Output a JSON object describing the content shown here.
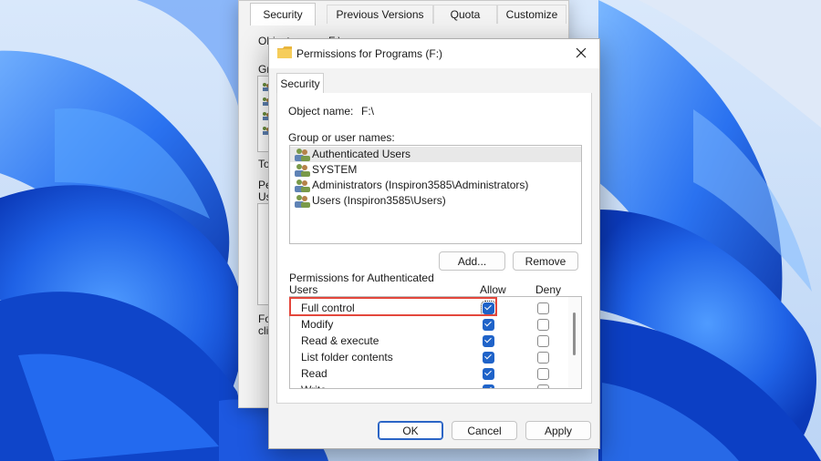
{
  "background_window": {
    "tabs": [
      "Security",
      "Previous Versions",
      "Quota",
      "Customize"
    ],
    "partial_labels": [
      "Object name:",
      "F:\\",
      "Gro",
      "To",
      "Pe",
      "Us",
      "Fo",
      "clic"
    ]
  },
  "dialog": {
    "title": "Permissions for Programs (F:)",
    "tab": "Security",
    "object_name_label": "Object name:",
    "object_name_value": "F:\\",
    "group_label": "Group or user names:",
    "users": [
      "Authenticated Users",
      "SYSTEM",
      "Administrators (Inspiron3585\\Administrators)",
      "Users (Inspiron3585\\Users)"
    ],
    "selected_user_index": 0,
    "add_button": "Add...",
    "remove_button": "Remove",
    "permissions_label_line1": "Permissions for Authenticated",
    "permissions_label_line2": "Users",
    "allow_header": "Allow",
    "deny_header": "Deny",
    "permissions": [
      {
        "name": "Full control",
        "allow": true,
        "deny": false
      },
      {
        "name": "Modify",
        "allow": true,
        "deny": false
      },
      {
        "name": "Read & execute",
        "allow": true,
        "deny": false
      },
      {
        "name": "List folder contents",
        "allow": true,
        "deny": false
      },
      {
        "name": "Read",
        "allow": true,
        "deny": false
      },
      {
        "name": "Write",
        "allow": true,
        "deny": false
      }
    ],
    "ok_button": "OK",
    "cancel_button": "Cancel",
    "apply_button": "Apply"
  },
  "colors": {
    "accent": "#1f63c9",
    "annotation": "#e4473c",
    "wallpaper_blue": "#1a5fe0"
  },
  "icons": {
    "title": "folder-icon",
    "users": "users-icon",
    "close": "close-icon"
  }
}
